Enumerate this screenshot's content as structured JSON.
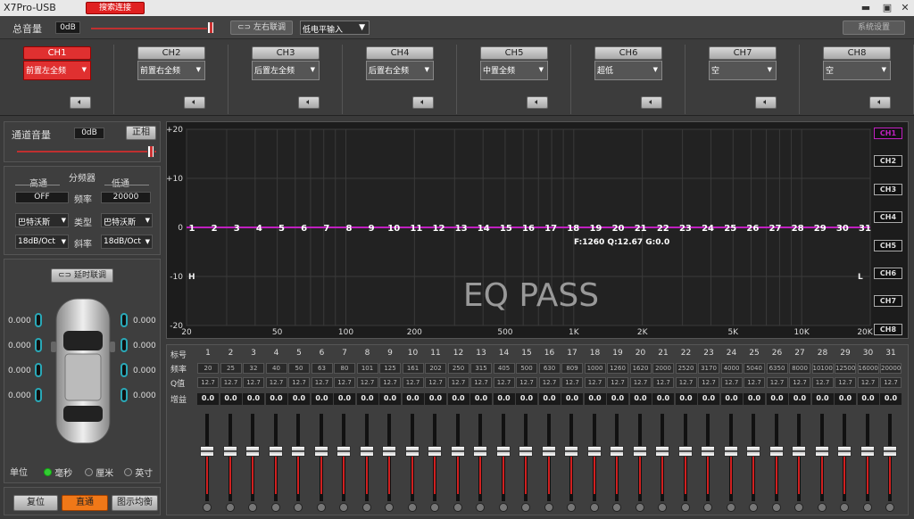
{
  "window": {
    "title": "X7Pro-USB",
    "search_label": "搜索连接"
  },
  "toolbar": {
    "master_label": "总音量",
    "master_value": "0dB",
    "master_level": 1.0,
    "link_lr_label": "左右联调",
    "input_select": "低电平输入",
    "settings_label": "系统设置"
  },
  "channels": [
    {
      "name": "CH1",
      "assign": "前置左全频",
      "active": true
    },
    {
      "name": "CH2",
      "assign": "前置右全频",
      "active": false
    },
    {
      "name": "CH3",
      "assign": "后置左全频",
      "active": false
    },
    {
      "name": "CH4",
      "assign": "后置右全频",
      "active": false
    },
    {
      "name": "CH5",
      "assign": "中置全频",
      "active": false
    },
    {
      "name": "CH6",
      "assign": "超低",
      "active": false
    },
    {
      "name": "CH7",
      "assign": "空",
      "active": false
    },
    {
      "name": "CH8",
      "assign": "空",
      "active": false
    }
  ],
  "left": {
    "ch_vol_label": "通道音量",
    "ch_vol_value": "0dB",
    "phase_label": "正相",
    "xover_title": "分频器",
    "hp_label": "高通",
    "lp_label": "低通",
    "hp_freq": "OFF",
    "freq_label": "频率",
    "lp_freq": "20000",
    "hp_type": "巴特沃斯",
    "type_label": "类型",
    "lp_type": "巴特沃斯",
    "hp_slope": "18dB/Oct",
    "slope_label": "斜率",
    "lp_slope": "18dB/Oct",
    "delay_link_label": "延时联调",
    "delays_left": [
      "0.000",
      "0.000",
      "0.000",
      "0.000"
    ],
    "delays_right": [
      "0.000",
      "0.000",
      "0.000",
      "0.000"
    ],
    "unit_label": "单位",
    "unit_ms": "毫秒",
    "unit_cm": "厘米",
    "unit_in": "英寸",
    "reset_label": "复位",
    "bypass_label": "直通",
    "graph_eq_label": "图示均衡"
  },
  "eq_graph": {
    "y_ticks": [
      "+20",
      "+10",
      "0",
      "-10",
      "-20"
    ],
    "x_ticks": [
      "20",
      "50",
      "100",
      "200",
      "500",
      "1K",
      "2K",
      "5K",
      "10K",
      "20K"
    ],
    "watermark": "EQ PASS",
    "readout": "F:1260 Q:12.67 G:0.0",
    "marker_h": "H",
    "marker_l": "L",
    "ch_tags": [
      "CH1",
      "CH2",
      "CH3",
      "CH4",
      "CH5",
      "CH6",
      "CH7",
      "CH8"
    ],
    "line_color": "#c020c0"
  },
  "bands": {
    "row_labels": [
      "标号",
      "频率",
      "Q值",
      "增益"
    ],
    "numbers": [
      "1",
      "2",
      "3",
      "4",
      "5",
      "6",
      "7",
      "8",
      "9",
      "10",
      "11",
      "12",
      "13",
      "14",
      "15",
      "16",
      "17",
      "18",
      "19",
      "20",
      "21",
      "22",
      "23",
      "24",
      "25",
      "26",
      "27",
      "28",
      "29",
      "30",
      "31"
    ],
    "freqs": [
      "20",
      "25",
      "32",
      "40",
      "50",
      "63",
      "80",
      "101",
      "125",
      "161",
      "202",
      "250",
      "315",
      "405",
      "500",
      "630",
      "809",
      "1000",
      "1260",
      "1620",
      "2000",
      "2520",
      "3170",
      "4000",
      "5040",
      "6350",
      "8000",
      "10100",
      "12500",
      "16000",
      "20000"
    ],
    "q": "12.7",
    "gain": "0.0"
  }
}
